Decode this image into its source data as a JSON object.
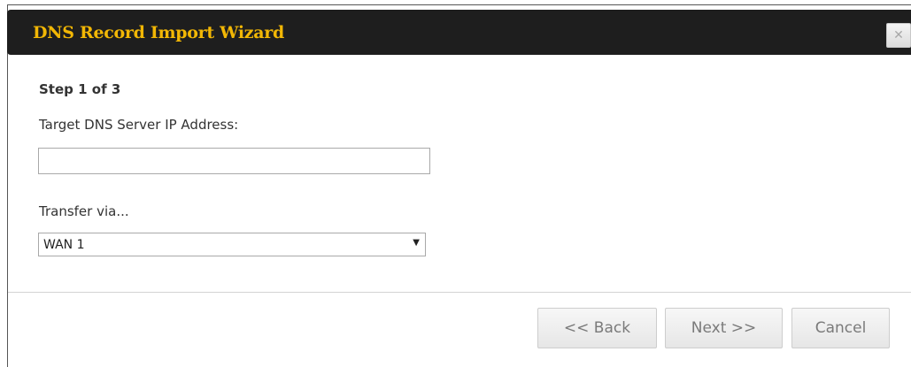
{
  "dialog": {
    "title": "DNS Record Import Wizard",
    "close_label": "✕"
  },
  "step": {
    "label": "Step 1 of 3"
  },
  "target_ip": {
    "label": "Target DNS Server IP Address:",
    "value": ""
  },
  "transfer": {
    "label": "Transfer via...",
    "selected": "WAN 1",
    "arrow": "▼"
  },
  "buttons": {
    "back": "<< Back",
    "next": "Next >>",
    "cancel": "Cancel"
  },
  "colors": {
    "titlebar_bg": "#1e1e1e",
    "title_text": "#f2b705",
    "button_text": "#7a7a7a"
  }
}
